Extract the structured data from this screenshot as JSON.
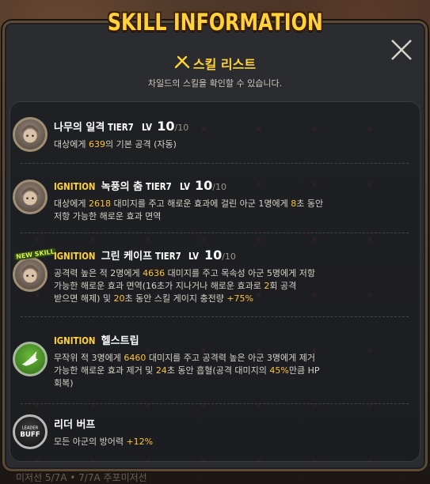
{
  "window": {
    "title": "SKILL INFORMATION",
    "header_title": "스킬 리스트",
    "header_subtitle": "차일드의 스킬을 확인할 수 있습니다.",
    "close_icon": "close-icon",
    "title_icon": "sword-crossed-icon"
  },
  "background": {
    "bottom_text": "미저선  5/7A • 7/7A 주포미저선"
  },
  "colors": {
    "accent": "#ffd23c",
    "highlight": "#ffc33a",
    "panel": "#1f2023"
  },
  "skills": [
    {
      "prefix": "",
      "name": "나무의 일격",
      "tier": "TIER7",
      "lv_label": "LV",
      "lv": "10",
      "lv_max": "/10",
      "desc": [
        "대상에게 ",
        "639",
        "의 기본 공격 (자동)"
      ]
    },
    {
      "prefix": "IGNITION",
      "name": "녹풍의 춤",
      "tier": "TIER7",
      "lv_label": "LV",
      "lv": "10",
      "lv_max": "/10",
      "desc_line1": [
        "대상에게 ",
        "2618",
        " 대미지를 주고 해로운 효과에 걸린 아군 1명에게 ",
        "8",
        "초 동안"
      ],
      "desc_line2": "저항 가능한 해로운 효과 면역"
    },
    {
      "prefix": "IGNITION",
      "name": "그린 케이프",
      "tier": "TIER7",
      "lv_label": "LV",
      "lv": "10",
      "lv_max": "/10",
      "badge": "NEW SKILL",
      "desc_line1": [
        "공격력 높은 적 2명에게 ",
        "4636",
        " 대미지를 주고 목속성 아군 5명에게 저항"
      ],
      "desc_line2": [
        "가능한 해로운 효과 면역(16초가 지나거나 해로운 효과로 ",
        "2",
        "회 공격"
      ],
      "desc_line3": [
        "받으면 해제) 및 ",
        "20",
        "초 동안 스킬 게이지 충전량 ",
        "+75%"
      ]
    },
    {
      "prefix": "IGNITION",
      "name": "헬스트립",
      "desc_line1": [
        "무작위 적 3명에게 ",
        "6460",
        " 대미지를 주고 공격력 높은 아군 3명에게 제거"
      ],
      "desc_line2": [
        "가능한 해로운 효과 제거 및 ",
        "24",
        "초 동안 흡혈(공격 대미지의 ",
        "45%",
        "만큼 HP"
      ],
      "desc_line3": "회복)"
    },
    {
      "prefix": "",
      "name": "리더 버프",
      "badge_text": "LEADER BUFF",
      "desc": [
        "모든 아군의 방어력 ",
        "+12%"
      ]
    }
  ]
}
